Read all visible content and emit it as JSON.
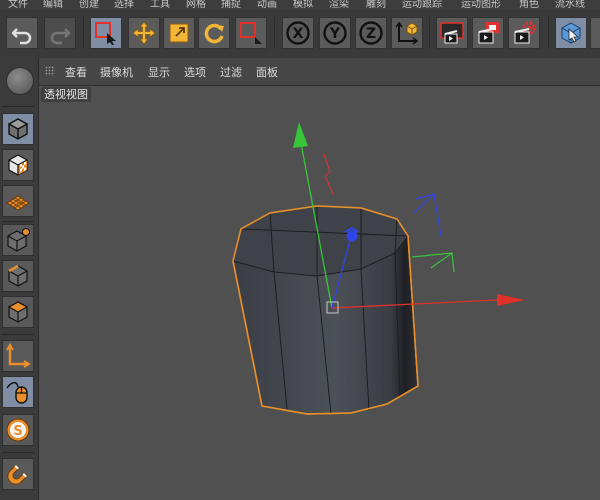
{
  "menu": {
    "items": [
      "文件",
      "编辑",
      "创建",
      "选择",
      "工具",
      "网格",
      "捕捉",
      "动画",
      "模拟",
      "渲染",
      "雕刻",
      "运动跟踪",
      "运动图形",
      "角色",
      "流水线"
    ]
  },
  "toolbar": {
    "buttons": [
      {
        "name": "undo-icon"
      },
      {
        "name": "redo-icon"
      },
      {
        "name": "live-selection-icon",
        "active": true
      },
      {
        "name": "move-icon"
      },
      {
        "name": "scale-icon"
      },
      {
        "name": "rotate-icon"
      },
      {
        "name": "recent-tool-icon"
      },
      {
        "name": "x-axis-lock-icon",
        "label": "X"
      },
      {
        "name": "y-axis-lock-icon",
        "label": "Y"
      },
      {
        "name": "z-axis-lock-icon",
        "label": "Z"
      },
      {
        "name": "coordinate-system-icon"
      },
      {
        "name": "render-view-icon"
      },
      {
        "name": "render-to-picture-viewer-icon"
      },
      {
        "name": "render-settings-icon"
      },
      {
        "name": "cube-primitive-icon"
      }
    ],
    "accent": "#e8b83a",
    "axis_colors": {
      "x": "#e0312b",
      "y": "#38c43a",
      "z": "#2e45e8"
    }
  },
  "viewport_menu": {
    "items": [
      "查看",
      "摄像机",
      "显示",
      "选项",
      "过滤",
      "面板"
    ]
  },
  "viewport": {
    "label": "透视视图",
    "object_outline_color": "#e8902a",
    "background": "#505050"
  },
  "left_toolbar": {
    "buttons": [
      {
        "name": "model-mode-icon",
        "active": true
      },
      {
        "name": "texture-mode-icon"
      },
      {
        "name": "workplane-mode-icon"
      },
      {
        "name": "points-mode-icon"
      },
      {
        "name": "edges-mode-icon"
      },
      {
        "name": "polygons-mode-icon"
      },
      {
        "name": "axis-mode-icon"
      },
      {
        "name": "tweak-mode-icon"
      },
      {
        "name": "snap-icon"
      },
      {
        "name": "magnet-icon"
      }
    ]
  }
}
